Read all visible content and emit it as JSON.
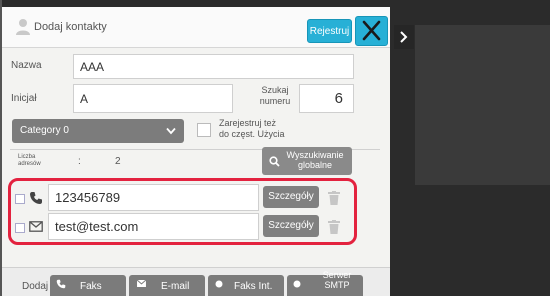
{
  "header": {
    "title": "Dodaj kontakty",
    "register_label": "Rejestruj"
  },
  "form": {
    "name_label": "Nazwa",
    "name_value": "AAA",
    "initial_label": "Inicjał",
    "initial_value": "A",
    "quick_search_label_line1": "Szukaj",
    "quick_search_label_line2": "numeru",
    "quick_search_value": "6",
    "category_value": "Category 0",
    "frequent_use_line1": "Zarejestruj też",
    "frequent_use_line2": "do częst. Użycia",
    "address_count_line1": "Liczba",
    "address_count_line2": "adresów",
    "address_count_sep": ":",
    "address_count_value": "2",
    "global_search_line1": "Wyszukiwanie",
    "global_search_line2": "globalne"
  },
  "addresses": [
    {
      "type_icon": "phone-icon",
      "value": "123456789",
      "detail_label": "Szczegóły"
    },
    {
      "type_icon": "mail-icon",
      "value": "test@test.com",
      "detail_label": "Szczegóły"
    }
  ],
  "footer": {
    "add_label": "Dodaj",
    "tabs": [
      {
        "label": "Faks",
        "icon": "fax-icon"
      },
      {
        "label": "E-mail",
        "icon": "email-icon"
      },
      {
        "label": "Faks Int.",
        "icon": "internet-fax-icon"
      },
      {
        "label_line1": "Serwer",
        "label_line2": "SMTP",
        "icon": "smtp-server-icon"
      }
    ]
  },
  "colors": {
    "accent": "#27b0d6",
    "highlight": "#e3223f",
    "grey_button": "#808080"
  }
}
